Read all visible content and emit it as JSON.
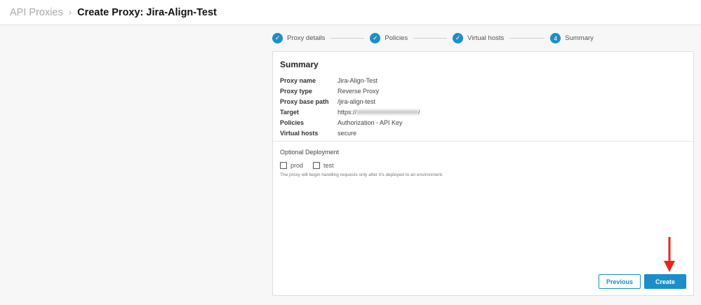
{
  "header": {
    "breadcrumb_parent": "API Proxies",
    "title": "Create Proxy: Jira-Align-Test"
  },
  "steps": [
    {
      "label": "Proxy details",
      "status": "done"
    },
    {
      "label": "Policies",
      "status": "done"
    },
    {
      "label": "Virtual hosts",
      "status": "done"
    },
    {
      "label": "Summary",
      "number": "4",
      "status": "current"
    }
  ],
  "summary": {
    "title": "Summary",
    "rows": [
      {
        "key": "Proxy name",
        "value": "Jira-Align-Test"
      },
      {
        "key": "Proxy type",
        "value": "Reverse Proxy"
      },
      {
        "key": "Proxy base path",
        "value": "/jira-align-test"
      },
      {
        "key": "Target",
        "value_prefix": "https://",
        "value_suffix": "/"
      },
      {
        "key": "Policies",
        "value": "Authorization - API Key"
      },
      {
        "key": "Virtual hosts",
        "value": "secure"
      }
    ]
  },
  "deployment": {
    "title": "Optional Deployment",
    "options": [
      {
        "label": "prod",
        "checked": false
      },
      {
        "label": "test",
        "checked": false
      }
    ],
    "note": "The proxy will begin handling requests only after it's deployed to an environment."
  },
  "buttons": {
    "previous": "Previous",
    "create": "Create"
  },
  "colors": {
    "accent": "#1a8fc9",
    "arrow": "#e8261c"
  }
}
